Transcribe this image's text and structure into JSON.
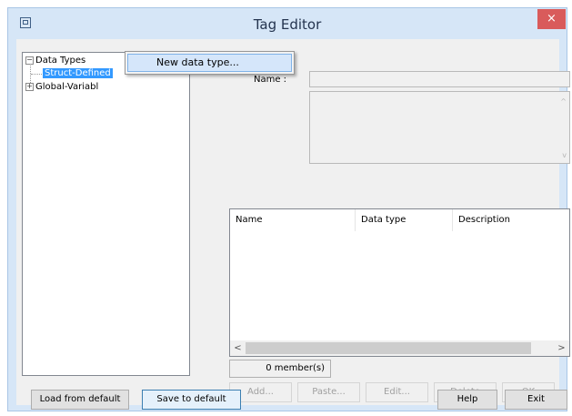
{
  "window": {
    "title": "Tag Editor",
    "close_glyph": "×"
  },
  "tree": {
    "root_label": "Data Types",
    "root_expander": "−",
    "child_struct": "Struct-Defined",
    "child_global": "Global-Variabl",
    "child_global_expander": "+"
  },
  "context_menu": {
    "new_data_type": "New data type..."
  },
  "form": {
    "name_label": "Name :"
  },
  "members_table": {
    "columns": [
      "Name",
      "Data type",
      "Description"
    ],
    "scroll_left": "<",
    "scroll_right": ">"
  },
  "member_count": "0 member(s)",
  "scroll_up": "^",
  "scroll_down": "v",
  "actions": {
    "add": "Add...",
    "paste": "Paste...",
    "edit": "Edit...",
    "delete": "Delete",
    "ok": "OK"
  },
  "footer": {
    "load": "Load from default",
    "save": "Save to default",
    "help": "Help",
    "exit": "Exit"
  }
}
